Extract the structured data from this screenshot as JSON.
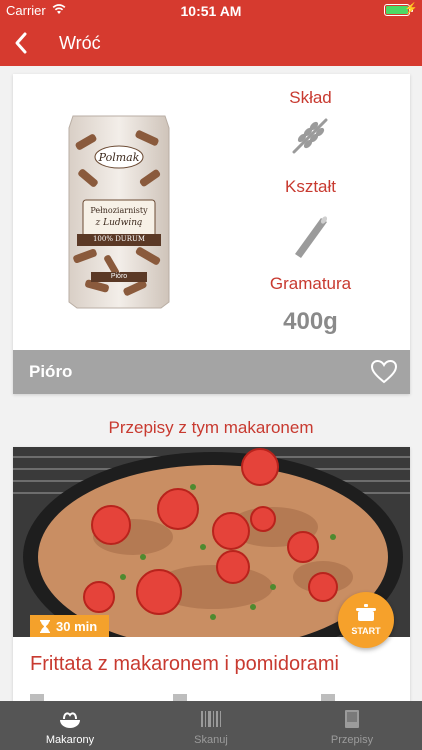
{
  "status_bar": {
    "carrier": "Carrier",
    "time": "10:51 AM",
    "battery_level": 1.0
  },
  "nav": {
    "back_label": "Wróć"
  },
  "product": {
    "package_brand": "Polmak",
    "package_name_line1": "Pełnoziarnisty",
    "package_name_line2": "z Ludwiną",
    "package_badge": "100% DURUM",
    "package_variant": "Pióro",
    "composition_label": "Skład",
    "shape_label": "Kształt",
    "grammage_label": "Gramatura",
    "grammage_value": "400g",
    "name": "Pióro"
  },
  "recipes": {
    "section_title": "Przepisy z tym makaronem",
    "items": [
      {
        "time": "30 min",
        "start_label": "START",
        "title": "Frittata z makaronem i pomidorami"
      }
    ]
  },
  "tabbar": {
    "tabs": [
      {
        "label": "Makarony",
        "icon": "pasta-bowl-icon",
        "active": true
      },
      {
        "label": "Skanuj",
        "icon": "barcode-icon",
        "active": false
      },
      {
        "label": "Przepisy",
        "icon": "book-icon",
        "active": false
      }
    ]
  },
  "colors": {
    "brand_red": "#d63a2f",
    "accent_orange": "#f6a12b",
    "tabbar_bg": "#555555",
    "name_bar": "#a4a4a4"
  }
}
